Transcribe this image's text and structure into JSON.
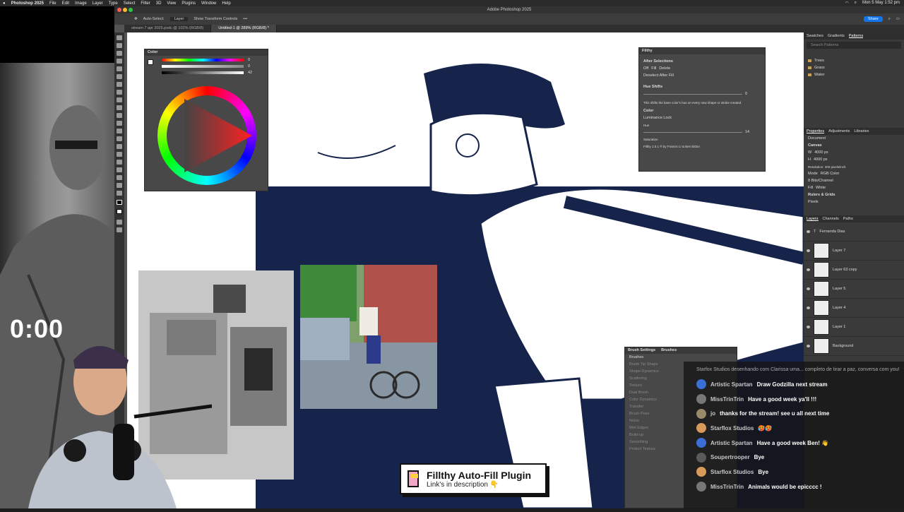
{
  "menubar": {
    "items": [
      "Photoshop 2025",
      "File",
      "Edit",
      "Image",
      "Layer",
      "Type",
      "Select",
      "Filter",
      "3D",
      "View",
      "Plugins",
      "Window",
      "Help"
    ],
    "datetime": "Mon 5 May 1:52 pm"
  },
  "stream": {
    "timer": "0:00"
  },
  "window": {
    "title": "Adobe Photoshop 2025"
  },
  "options_bar": {
    "auto_select": "Auto-Select:",
    "layer_select": "Layer",
    "show_transform": "Show Transform Controls",
    "share": "Share"
  },
  "tabs": [
    {
      "label": "stream 7 apr 2025.psdc @ 102% (RGB/8)"
    },
    {
      "label": "Untitled-1 @ 289% (RGB/8) *"
    }
  ],
  "color_panel": {
    "title": "Color",
    "vals": [
      "0",
      "0",
      "42"
    ]
  },
  "filthy_panel": {
    "title": "Filthy",
    "after_selections": "After Selections",
    "opt_off": "Off",
    "opt_fill": "Fill",
    "opt_delete": "Delete",
    "deselect": "Deselect After Fill",
    "hue_shifts": "Hue Shifts",
    "hue_value": "0",
    "hue_desc": "This shifts the base color's hue on every new shape or stroke created.",
    "color": "Color",
    "lum_lock": "Luminance Lock",
    "hue": "Hue",
    "sat_value": "14",
    "saturation": "Saturation",
    "credit": "Filthy 1.0.1 ® by Francis LI & Ben Eldon"
  },
  "brush_panel": {
    "tabs": [
      "Brush Settings",
      "Brushes"
    ],
    "brushes_btn": "Brushes",
    "options": [
      "Brush Tip Shape",
      "Shape Dynamics",
      "Scattering",
      "Texture",
      "Dual Brush",
      "Color Dynamics",
      "Transfer",
      "Brush Pose",
      "Noise",
      "Wet Edges",
      "Build-up",
      "Smoothing",
      "Protect Texture"
    ]
  },
  "dock": {
    "top_tabs": [
      "Swatches",
      "Gradients",
      "Patterns"
    ],
    "search": "Search Patterns",
    "folders": [
      "Trees",
      "Grass",
      "Water"
    ],
    "prop_tabs": [
      "Properties",
      "Adjustments",
      "Libraries"
    ],
    "document": "Document",
    "canvas": "Canvas",
    "w": "4000 px",
    "h": "4000 px",
    "resolution": "Resolution: 300 pixels/inch",
    "mode_label": "Mode",
    "mode": "RGB Color",
    "bits": "8 Bits/Channel",
    "fill_label": "Fill",
    "fill": "White",
    "rulers": "Rulers & Grids",
    "pixels": "Pixels",
    "layer_tabs": [
      "Layers",
      "Channels",
      "Paths"
    ],
    "layers": [
      {
        "name": "Fernanda Dias",
        "kind": "type"
      },
      {
        "name": "Layer 7",
        "kind": "pixel"
      },
      {
        "name": "Layer 63 copy",
        "kind": "pixel"
      },
      {
        "name": "Layer 5",
        "kind": "pixel"
      },
      {
        "name": "Layer 4",
        "kind": "pixel"
      },
      {
        "name": "Layer 1",
        "kind": "pixel"
      },
      {
        "name": "Background",
        "kind": "pixel"
      }
    ]
  },
  "chat": {
    "partial": "Starfox Studios  desenhando com Clarissa uma... completo de tirar a paz, conversa com you!",
    "messages": [
      {
        "user": "Artistic Spartan",
        "text": "Draw Godzilla next stream",
        "color": "#3b6fd6"
      },
      {
        "user": "MissTrinTrin",
        "text": "Have a good week ya'll !!!",
        "color": "#777777"
      },
      {
        "user": "jo",
        "text": "thanks for the stream! see u all next time",
        "color": "#9a8a6a"
      },
      {
        "user": "Starflox Studios",
        "text": "🥵🥵",
        "color": "#d89a5a"
      },
      {
        "user": "Artistic Spartan",
        "text": "Have a good week Ben! 👋",
        "color": "#3b6fd6"
      },
      {
        "user": "Soupertrooper",
        "text": "Bye",
        "color": "#5a5a5a"
      },
      {
        "user": "Starflox Studios",
        "text": "Bye",
        "color": "#d89a5a"
      },
      {
        "user": "MissTrinTrin",
        "text": "Animals would be epicccc !",
        "color": "#777777"
      }
    ]
  },
  "banner": {
    "title": "Fillthy Auto-Fill Plugin",
    "subtitle": "Link's in description 👇"
  },
  "colors": {
    "navy": "#16234a",
    "ps_bg": "#535353",
    "accent": "#1473e6"
  }
}
